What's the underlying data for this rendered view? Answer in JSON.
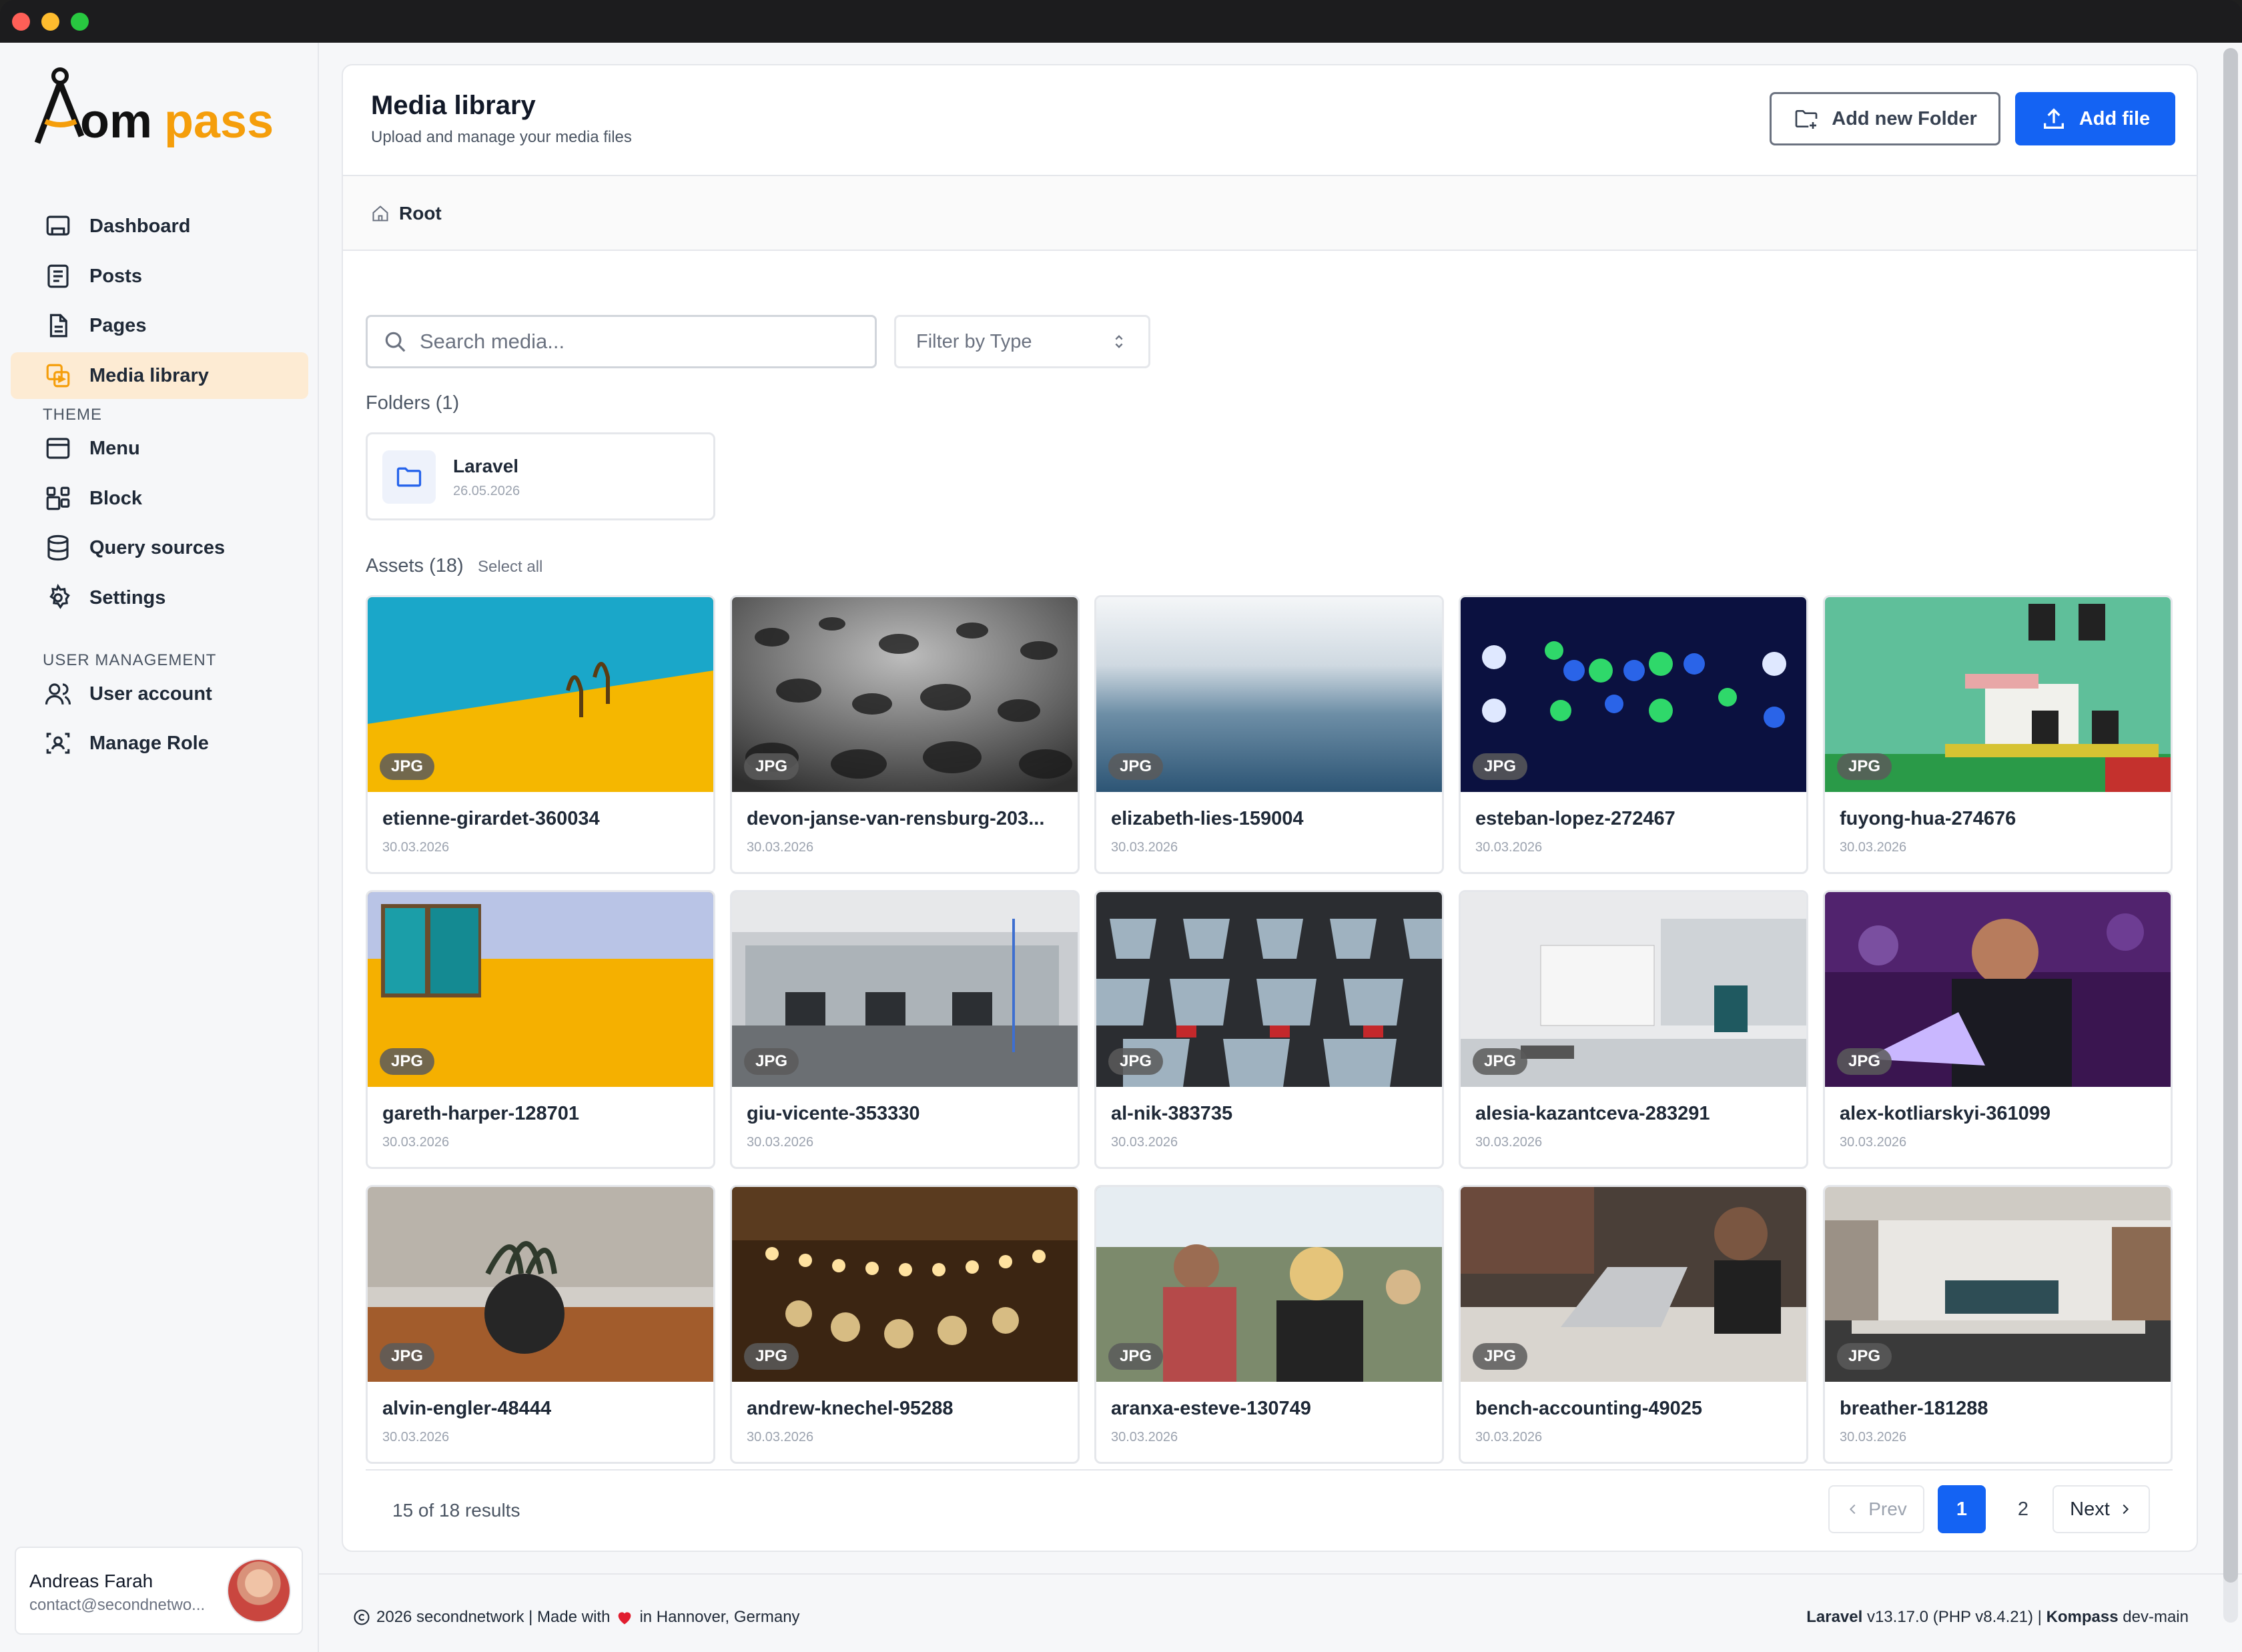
{
  "app": {
    "brand": "Kompass",
    "accent": "#f59e0b",
    "primary": "#1463f3"
  },
  "sidebar": {
    "items": [
      {
        "label": "Dashboard",
        "icon": "dashboard-icon"
      },
      {
        "label": "Posts",
        "icon": "posts-icon"
      },
      {
        "label": "Pages",
        "icon": "pages-icon"
      },
      {
        "label": "Media library",
        "icon": "media-icon",
        "active": true
      }
    ],
    "theme_title": "THEME",
    "theme_items": [
      {
        "label": "Menu",
        "icon": "menu-icon"
      },
      {
        "label": "Block",
        "icon": "block-icon"
      },
      {
        "label": "Query sources",
        "icon": "database-icon"
      },
      {
        "label": "Settings",
        "icon": "gear-icon"
      }
    ],
    "user_title": "USER MANAGEMENT",
    "user_items": [
      {
        "label": "User account",
        "icon": "users-icon"
      },
      {
        "label": "Manage Role",
        "icon": "role-icon"
      }
    ],
    "user": {
      "name": "Andreas Farah",
      "email": "contact@secondnetwo..."
    }
  },
  "header": {
    "title": "Media library",
    "subtitle": "Upload and manage your media files",
    "add_folder": "Add new Folder",
    "add_file": "Add file"
  },
  "breadcrumb": {
    "root": "Root"
  },
  "search": {
    "placeholder": "Search media..."
  },
  "filter": {
    "label": "Filter by Type"
  },
  "folders": {
    "title": "Folders (1)",
    "items": [
      {
        "name": "Laravel",
        "date": "26.05.2026"
      }
    ]
  },
  "assets": {
    "title": "Assets (18)",
    "select_all": "Select all",
    "items": [
      {
        "name": "etienne-girardet-360034",
        "date": "30.03.2026",
        "type": "JPG"
      },
      {
        "name": "devon-janse-van-rensburg-203...",
        "date": "30.03.2026",
        "type": "JPG"
      },
      {
        "name": "elizabeth-lies-159004",
        "date": "30.03.2026",
        "type": "JPG"
      },
      {
        "name": "esteban-lopez-272467",
        "date": "30.03.2026",
        "type": "JPG"
      },
      {
        "name": "fuyong-hua-274676",
        "date": "30.03.2026",
        "type": "JPG"
      },
      {
        "name": "gareth-harper-128701",
        "date": "30.03.2026",
        "type": "JPG"
      },
      {
        "name": "giu-vicente-353330",
        "date": "30.03.2026",
        "type": "JPG"
      },
      {
        "name": "al-nik-383735",
        "date": "30.03.2026",
        "type": "JPG"
      },
      {
        "name": "alesia-kazantceva-283291",
        "date": "30.03.2026",
        "type": "JPG"
      },
      {
        "name": "alex-kotliarskyi-361099",
        "date": "30.03.2026",
        "type": "JPG"
      },
      {
        "name": "alvin-engler-48444",
        "date": "30.03.2026",
        "type": "JPG"
      },
      {
        "name": "andrew-knechel-95288",
        "date": "30.03.2026",
        "type": "JPG"
      },
      {
        "name": "aranxa-esteve-130749",
        "date": "30.03.2026",
        "type": "JPG"
      },
      {
        "name": "bench-accounting-49025",
        "date": "30.03.2026",
        "type": "JPG"
      },
      {
        "name": "breather-181288",
        "date": "30.03.2026",
        "type": "JPG"
      }
    ]
  },
  "pagination": {
    "results": "15 of 18 results",
    "prev": "Prev",
    "page1": "1",
    "page2": "2",
    "next": "Next"
  },
  "footer": {
    "left_prefix": "2026 secondnetwork | Made with",
    "left_suffix": "in Hannover, Germany",
    "framework": "Laravel",
    "framework_version": "v13.17.0 (PHP v8.4.21) |",
    "product": "Kompass",
    "product_version": "dev-main"
  }
}
